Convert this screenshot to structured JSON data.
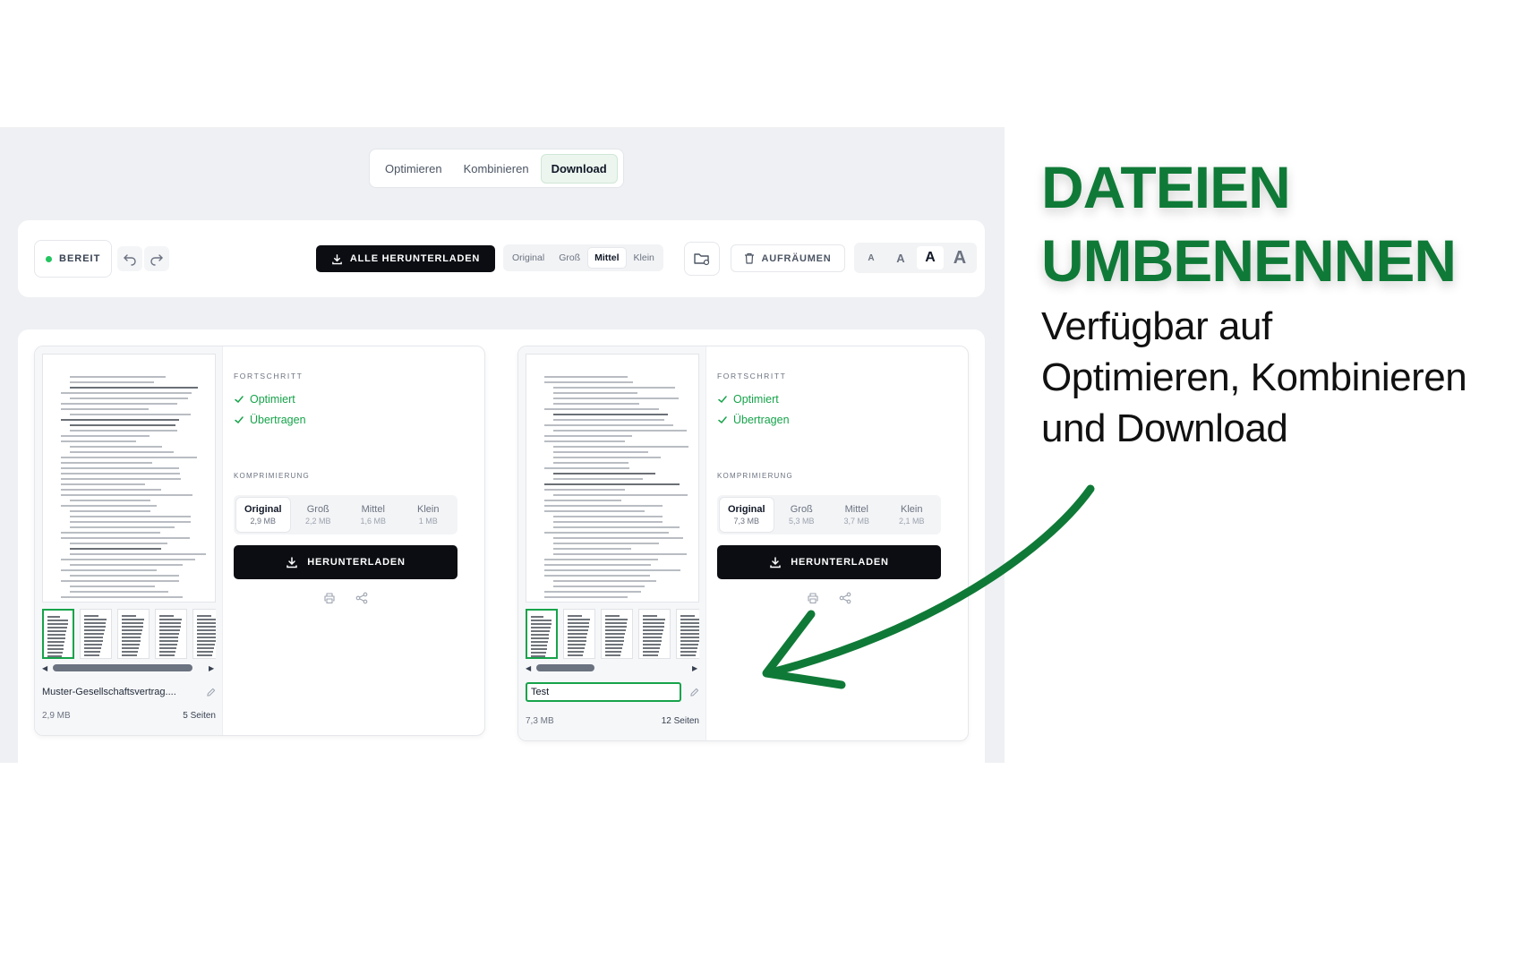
{
  "tabs": {
    "optimize": "Optimieren",
    "combine": "Kombinieren",
    "download": "Download",
    "active": "Download"
  },
  "toolbar": {
    "status": "BEREIT",
    "download_all": "ALLE HERUNTERLADEN",
    "sizes": [
      "Original",
      "Groß",
      "Mittel",
      "Klein"
    ],
    "size_selected": "Mittel",
    "cleanup": "AUFRÄUMEN",
    "font_sizes": [
      "A",
      "A",
      "A",
      "A"
    ],
    "font_selected_index": 2
  },
  "files": [
    {
      "name": "Muster-Gesellschaftsvertrag....",
      "editing": false,
      "size": "2,9 MB",
      "pages": "5 Seiten",
      "progress_label": "FORTSCHRITT",
      "progress": [
        "Optimiert",
        "Übertragen"
      ],
      "compression_label": "KOMPRIMIERUNG",
      "compression": [
        {
          "label": "Original",
          "size": "2,9 MB"
        },
        {
          "label": "Groß",
          "size": "2,2 MB"
        },
        {
          "label": "Mittel",
          "size": "1,6 MB"
        },
        {
          "label": "Klein",
          "size": "1 MB"
        }
      ],
      "compression_selected": "Original",
      "download": "HERUNTERLADEN"
    },
    {
      "name": "Test",
      "editing": true,
      "size": "7,3 MB",
      "pages": "12 Seiten",
      "progress_label": "FORTSCHRITT",
      "progress": [
        "Optimiert",
        "Übertragen"
      ],
      "compression_label": "KOMPRIMIERUNG",
      "compression": [
        {
          "label": "Original",
          "size": "7,3 MB"
        },
        {
          "label": "Groß",
          "size": "5,3 MB"
        },
        {
          "label": "Mittel",
          "size": "3,7 MB"
        },
        {
          "label": "Klein",
          "size": "2,1 MB"
        }
      ],
      "compression_selected": "Original",
      "download": "HERUNTERLADEN"
    }
  ],
  "promo": {
    "headline_1": "DATEIEN",
    "headline_2": "UMBENENNEN",
    "sub_1": "Verfügbar auf",
    "sub_2": "Optimieren, Kombinieren",
    "sub_3": "und Download"
  },
  "colors": {
    "accent_green": "#0f7a37",
    "success": "#16a34a",
    "dark_button": "#0b0d12"
  }
}
